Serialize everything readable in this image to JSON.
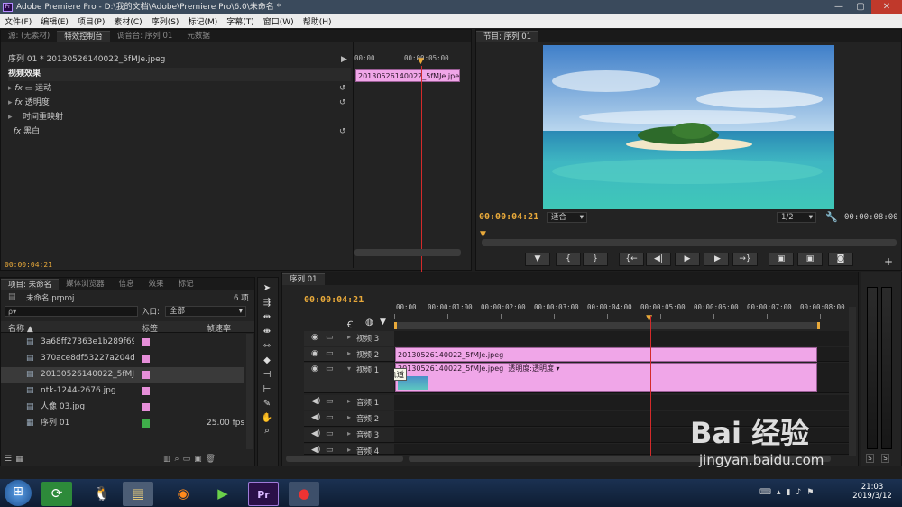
{
  "window": {
    "title": "Adobe Premiere Pro - D:\\我的文档\\Adobe\\Premiere Pro\\6.0\\未命名 *",
    "controls": [
      "—",
      "▢",
      "✕"
    ]
  },
  "menu": [
    "文件(F)",
    "编辑(E)",
    "项目(P)",
    "素材(C)",
    "序列(S)",
    "标记(M)",
    "字幕(T)",
    "窗口(W)",
    "帮助(H)"
  ],
  "source_panel": {
    "tabs": [
      "源: (无素材)",
      "特效控制台",
      "调音台: 序列 01",
      "元数据"
    ],
    "active_tab": 1,
    "clip_header": "序列 01 * 20130526140022_5fMJe.jpeg",
    "section": "视频效果",
    "effects": [
      {
        "label": "运动",
        "fx": "fx"
      },
      {
        "label": "透明度",
        "fx": "fx"
      },
      {
        "label": "时间重映射",
        "fx": ""
      },
      {
        "label": "黑白",
        "fx": "fx"
      }
    ],
    "ruler_time": "00:00:05:00",
    "ruler_start": "00:00",
    "clip_name": "20130526140022_5fMJe.jpeg",
    "timecode": "00:00:04:21"
  },
  "program_monitor": {
    "tab": "节目: 序列 01",
    "timecode": "00:00:04:21",
    "fit": "适合",
    "ratio": "1/2",
    "duration": "00:00:08:00",
    "buttons": [
      "▼",
      "{",
      "}",
      "{←",
      "◀|",
      "▶",
      "|▶",
      "→}",
      "▣",
      "▣",
      "◙"
    ]
  },
  "project_panel": {
    "tabs": [
      "项目: 未命名",
      "媒体浏览器",
      "信息",
      "效果",
      "标记"
    ],
    "project_name": "未命名.prproj",
    "item_count": "6 项",
    "search_placeholder": "ρ▾",
    "in_label": "入口:",
    "in_value": "全部",
    "columns": [
      "名称 ▲",
      "标签",
      "帧速率"
    ],
    "items": [
      {
        "name": "3a68ff27363e1b289f69628c",
        "label_color": "#e68fd9",
        "fps": "",
        "icon": "image-icon"
      },
      {
        "name": "370ace8df53227a204d64c7",
        "label_color": "#e68fd9",
        "fps": "",
        "icon": "image-icon"
      },
      {
        "name": "20130526140022_5fMJe.jpe",
        "label_color": "#e68fd9",
        "fps": "",
        "icon": "image-icon"
      },
      {
        "name": "ntk-1244-2676.jpg",
        "label_color": "#e68fd9",
        "fps": "",
        "icon": "image-icon"
      },
      {
        "name": "人像 03.jpg",
        "label_color": "#e68fd9",
        "fps": "",
        "icon": "image-icon"
      },
      {
        "name": "序列 01",
        "label_color": "#3fae4a",
        "fps": "25.00 fps",
        "icon": "sequence-icon"
      }
    ]
  },
  "timeline": {
    "tab": "序列 01",
    "timecode": "00:00:04:21",
    "ruler": [
      "00:00",
      "00:00:01:00",
      "00:00:02:00",
      "00:00:03:00",
      "00:00:04:00",
      "00:00:05:00",
      "00:00:06:00",
      "00:00:07:00",
      "00:00:08:00"
    ],
    "tracks": [
      {
        "name": "视频 3",
        "type": "video"
      },
      {
        "name": "视频 2",
        "type": "video",
        "clip": "20130526140022_5fMJe.jpeg"
      },
      {
        "name": "视频 1",
        "type": "video",
        "clip": "20130526140022_5fMJe.jpeg",
        "sub": "透明度:透明度 ▾"
      },
      {
        "name": "音频 1",
        "type": "audio"
      },
      {
        "name": "音频 2",
        "type": "audio"
      },
      {
        "name": "音频 3",
        "type": "audio"
      },
      {
        "name": "音频 4",
        "type": "audio"
      }
    ],
    "tooltip": "折叠-展开轨道",
    "playhead_fraction": 0.602
  },
  "audio_meter": {
    "labels": [
      "S",
      "S"
    ]
  },
  "taskbar": {
    "time": "21:03",
    "date": "2019/3/12"
  },
  "watermark": {
    "text": "Bai 经验",
    "url": "jingyan.baidu.com"
  }
}
